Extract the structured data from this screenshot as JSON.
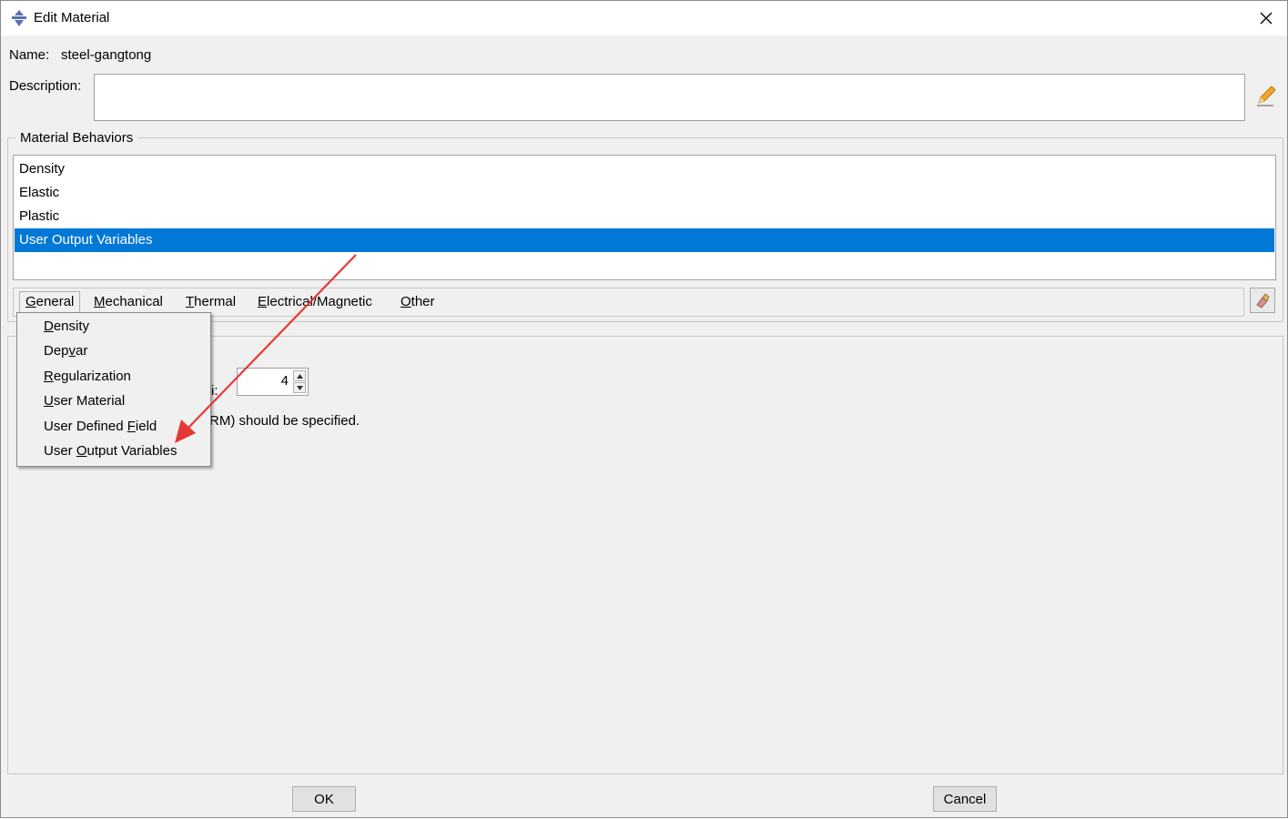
{
  "window": {
    "title": "Edit Material"
  },
  "form": {
    "name_label": "Name:",
    "name_value": "steel-gangtong",
    "description_label": "Description:",
    "description_value": ""
  },
  "behaviors": {
    "group_title": "Material Behaviors",
    "items": [
      {
        "label": "Density",
        "selected": false
      },
      {
        "label": "Elastic",
        "selected": false
      },
      {
        "label": "Plastic",
        "selected": false
      },
      {
        "label": "User Output Variables",
        "selected": true
      }
    ]
  },
  "menubar": {
    "items": [
      {
        "label": "General",
        "mnemonic": "G",
        "rest": "eneral"
      },
      {
        "label": "Mechanical",
        "mnemonic": "M",
        "rest": "echanical"
      },
      {
        "label": "Thermal",
        "mnemonic": "T",
        "rest": "hermal"
      },
      {
        "label": "Electrical/Magnetic",
        "mnemonic": "E",
        "rest": "lectrical/Magnetic"
      },
      {
        "label": "Other",
        "mnemonic": "O",
        "rest": "ther"
      }
    ]
  },
  "dropdown": {
    "items": [
      {
        "pre": "",
        "mn": "D",
        "post": "ensity"
      },
      {
        "pre": "Dep",
        "mn": "v",
        "post": "ar"
      },
      {
        "pre": "",
        "mn": "R",
        "post": "egularization"
      },
      {
        "pre": "",
        "mn": "U",
        "post": "ser Material"
      },
      {
        "pre": "User Defined ",
        "mn": "F",
        "post": "ield"
      },
      {
        "pre": "User ",
        "mn": "O",
        "post": "utput Variables"
      }
    ]
  },
  "editor": {
    "fragment_label": "i",
    "fragment_colon": ":",
    "spin_value": "4",
    "note_text": "RM) should be specified."
  },
  "buttons": {
    "ok": "OK",
    "cancel": "Cancel"
  },
  "colors": {
    "selection": "#0078d7",
    "arrow": "#e53935"
  }
}
